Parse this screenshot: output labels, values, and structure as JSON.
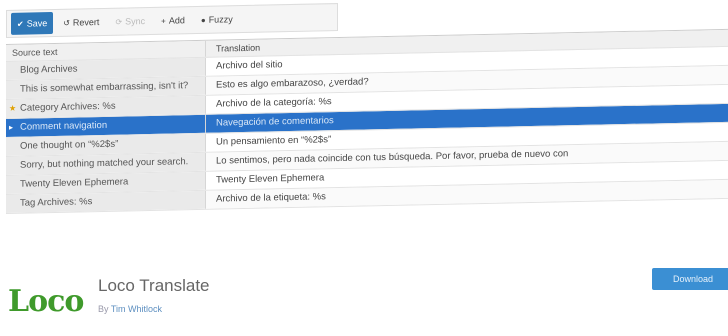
{
  "toolbar": {
    "buttons": [
      {
        "label": "Save",
        "icon": "save-icon"
      },
      {
        "label": "Revert",
        "icon": "revert-icon"
      },
      {
        "label": "Sync",
        "icon": "sync-icon"
      },
      {
        "label": "Add",
        "icon": "add-icon"
      },
      {
        "label": "Fuzzy",
        "icon": "fuzzy-icon"
      }
    ]
  },
  "grid": {
    "headers": {
      "source": "Source text",
      "target": "Translation"
    },
    "rows": [
      {
        "source": "Blog Archives",
        "target": "Archivo del sitio"
      },
      {
        "source": "This is somewhat embarrassing, isn't it?",
        "target": "Esto es algo embarazoso, ¿verdad?"
      },
      {
        "source": "Category Archives: %s",
        "target": "Archivo de la categoría: %s",
        "mark": "★"
      },
      {
        "source": "Comment navigation",
        "target": "Navegación de comentarios",
        "mark": "▸",
        "selected": true
      },
      {
        "source": "One thought on “%2$s”",
        "target": "Un pensamiento en “%2$s”"
      },
      {
        "source": "Sorry, but nothing matched your search.",
        "target": "Lo sentimos, pero nada coincide con tus búsqueda. Por favor, prueba de nuevo con"
      },
      {
        "source": "Twenty Eleven Ephemera",
        "target": "Twenty Eleven Ephemera"
      },
      {
        "source": "Tag Archives: %s",
        "target": "Archivo de la etiqueta: %s"
      }
    ]
  },
  "plugin": {
    "logo_text": "Loco",
    "title": "Loco Translate",
    "author_prefix": "By",
    "author": "Tim Whitlock",
    "download_label": "Download"
  },
  "colors": {
    "accent": "#2a72c9",
    "logo": "#3f9a2b",
    "download": "#3b8fd3"
  }
}
